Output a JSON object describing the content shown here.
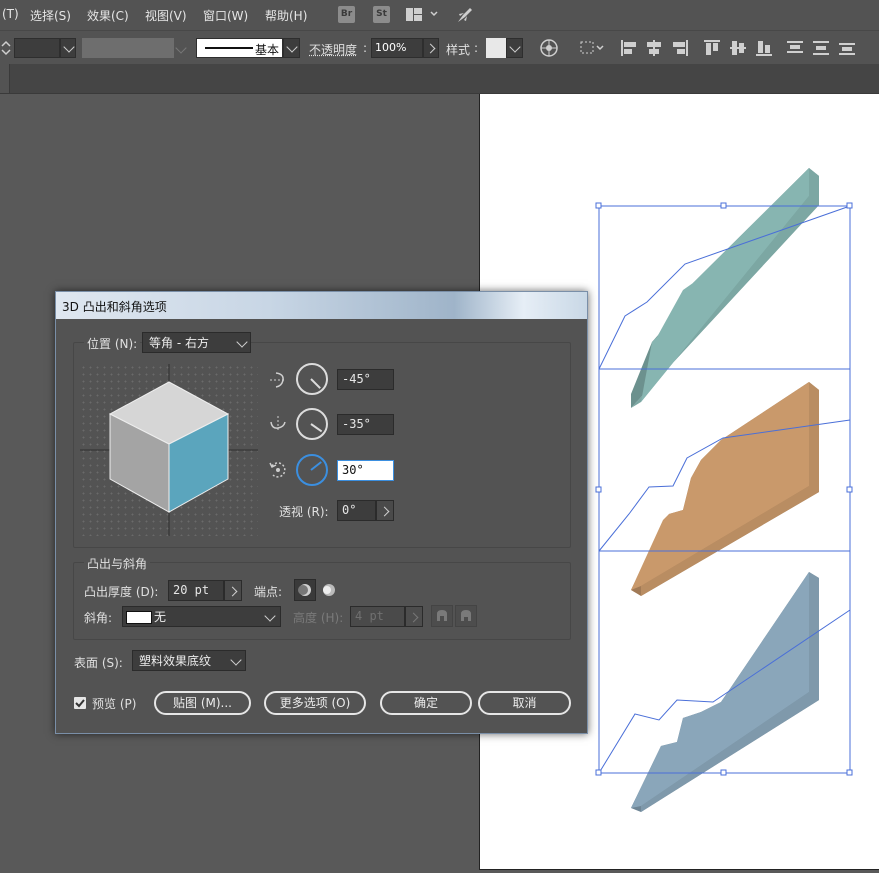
{
  "menu": {
    "items": [
      "(T)",
      "选择(S)",
      "效果(C)",
      "视图(V)",
      "窗口(W)",
      "帮助(H)"
    ],
    "icons": [
      "Br",
      "St"
    ]
  },
  "controlbar": {
    "stroke_profile": "基本",
    "opacity_label": "不透明度",
    "opacity_value": "100%",
    "style_label": "样式"
  },
  "dialog": {
    "title": "3D 凸出和斜角选项",
    "position_label": "位置 (N):",
    "position_value": "等角 - 右方",
    "rotation_x": "-45°",
    "rotation_y": "-35°",
    "rotation_z": "30°",
    "perspective_label": "透视 (R):",
    "perspective_value": "0°",
    "extrude_group_label": "凸出与斜角",
    "extrude_depth_label": "凸出厚度 (D):",
    "extrude_depth_value": "20 pt",
    "cap_label": "端点:",
    "bevel_label": "斜角:",
    "bevel_value": "无",
    "height_label": "高度 (H):",
    "height_value": "4 pt",
    "surface_label": "表面 (S):",
    "surface_value": "塑料效果底纹",
    "preview_label": "预览 (P)",
    "preview_checked": true,
    "map_button": "贴图 (M)...",
    "more_options_button": "更多选项 (O)",
    "ok_button": "确定",
    "cancel_button": "取消"
  },
  "colors": {
    "cube_top": "#d6d6d6",
    "cube_left": "#a4a4a4",
    "cube_right": "#5ba5bd",
    "shape1": "#87b5b1",
    "shape2": "#c9996b",
    "shape3": "#8aa6ba",
    "selection": "#4a6fd8"
  }
}
